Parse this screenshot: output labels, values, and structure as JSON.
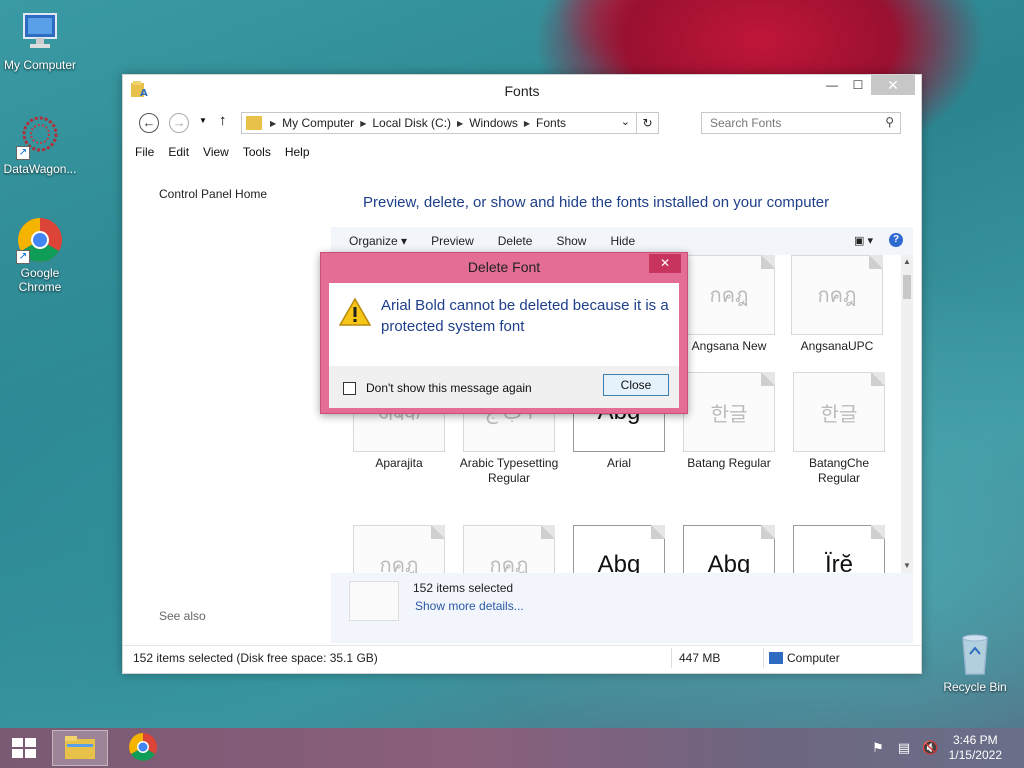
{
  "desktop": {
    "icons": [
      {
        "label": "My Computer"
      },
      {
        "label": "DataWagon..."
      },
      {
        "label": "Google Chrome"
      },
      {
        "label": "Recycle Bin"
      }
    ]
  },
  "window": {
    "title": "Fonts",
    "nav": {
      "breadcrumbs": [
        "My Computer",
        "Local Disk (C:)",
        "Windows",
        "Fonts"
      ],
      "search_placeholder": "Search Fonts"
    },
    "menu": [
      "File",
      "Edit",
      "View",
      "Tools",
      "Help"
    ],
    "left_pane": {
      "home": "Control Panel Home",
      "see_also": "See also"
    },
    "heading": "Preview, delete, or show and hide the fonts installed on your computer",
    "commands": [
      "Organize",
      "Preview",
      "Delete",
      "Show",
      "Hide"
    ],
    "fonts": [
      {
        "name": "Angsana New",
        "sample": "กคฎ"
      },
      {
        "name": "AngsanaUPC",
        "sample": "กคฎ"
      },
      {
        "name": "Aparajita",
        "sample": "अबक"
      },
      {
        "name": "Arabic Typesetting Regular",
        "sample": "أ ب ج"
      },
      {
        "name": "Arial",
        "sample": "Abg"
      },
      {
        "name": "Batang Regular",
        "sample": "한글"
      },
      {
        "name": "BatangChe Regular",
        "sample": "한글"
      },
      {
        "name": "",
        "sample": "กคฎ"
      },
      {
        "name": "",
        "sample": "กคฎ"
      },
      {
        "name": "",
        "sample": "Abg"
      },
      {
        "name": "",
        "sample": "Abg"
      },
      {
        "name": "",
        "sample": "Ïrĕ"
      }
    ],
    "details": {
      "count": "152 items selected",
      "more": "Show more details..."
    },
    "status": {
      "selection": "152 items selected (Disk free space: 35.1 GB)",
      "size": "447 MB",
      "location": "Computer"
    }
  },
  "dialog": {
    "title": "Delete Font",
    "message": "Arial Bold cannot be deleted because it is a protected system font",
    "checkbox_label": "Don't show this message again",
    "close_label": "Close",
    "close_glyph": "✕"
  },
  "taskbar": {
    "time": "3:46 PM",
    "date": "1/15/2022"
  }
}
